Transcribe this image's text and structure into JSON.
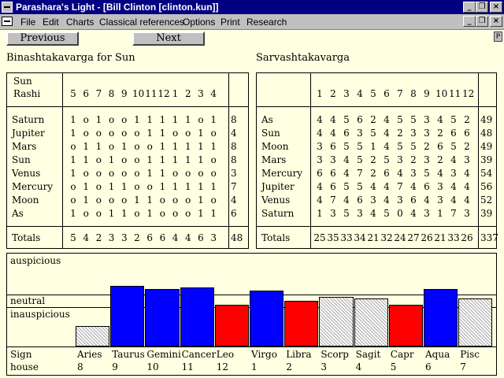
{
  "window": {
    "title": "Parashara's Light - [Bill  Clinton [clinton.kun]]",
    "min_label": "_",
    "restore_label": "❐",
    "close_label": "×"
  },
  "menu": [
    "File",
    "Edit",
    "Charts",
    "Classical references",
    "Options",
    "Print",
    "Research"
  ],
  "nav": {
    "previous": "Previous",
    "next": "Next",
    "print_small": "P"
  },
  "bav": {
    "heading": "Binashtakavarga for Sun",
    "header_label_1": "Sun",
    "header_label_2": "Rashi",
    "rashi": [
      "5",
      "6",
      "7",
      "8",
      "9",
      "10",
      "11",
      "12",
      "1",
      "2",
      "3",
      "4"
    ],
    "rows": [
      {
        "label": "Saturn",
        "values": [
          "1",
          "o",
          "1",
          "o",
          "o",
          "1",
          "1",
          "1",
          "1",
          "1",
          "o",
          "1"
        ],
        "total": "8"
      },
      {
        "label": "Jupiter",
        "values": [
          "1",
          "o",
          "o",
          "o",
          "o",
          "o",
          "1",
          "1",
          "o",
          "o",
          "1",
          "o"
        ],
        "total": "4"
      },
      {
        "label": "Mars",
        "values": [
          "o",
          "1",
          "1",
          "o",
          "1",
          "o",
          "o",
          "1",
          "1",
          "1",
          "1",
          "1"
        ],
        "total": "8"
      },
      {
        "label": "Sun",
        "values": [
          "1",
          "1",
          "o",
          "1",
          "o",
          "o",
          "1",
          "1",
          "1",
          "1",
          "1",
          "o"
        ],
        "total": "8"
      },
      {
        "label": "Venus",
        "values": [
          "1",
          "o",
          "o",
          "o",
          "o",
          "o",
          "1",
          "1",
          "o",
          "o",
          "o",
          "o"
        ],
        "total": "3"
      },
      {
        "label": "Mercury",
        "values": [
          "o",
          "1",
          "o",
          "1",
          "1",
          "o",
          "o",
          "1",
          "1",
          "1",
          "1",
          "1"
        ],
        "total": "7"
      },
      {
        "label": "Moon",
        "values": [
          "o",
          "1",
          "o",
          "o",
          "o",
          "1",
          "1",
          "o",
          "o",
          "o",
          "1",
          "o"
        ],
        "total": "4"
      },
      {
        "label": "As",
        "values": [
          "1",
          "o",
          "o",
          "1",
          "1",
          "o",
          "1",
          "o",
          "o",
          "o",
          "1",
          "1"
        ],
        "total": "6"
      }
    ],
    "totals_label": "Totals",
    "totals": [
      "5",
      "4",
      "2",
      "3",
      "3",
      "2",
      "6",
      "6",
      "4",
      "4",
      "6",
      "3"
    ],
    "grand_total": "48"
  },
  "sav": {
    "heading": "Sarvashtakavarga",
    "houses": [
      "1",
      "2",
      "3",
      "4",
      "5",
      "6",
      "7",
      "8",
      "9",
      "10",
      "11",
      "12"
    ],
    "rows": [
      {
        "label": "As",
        "values": [
          "4",
          "4",
          "5",
          "6",
          "2",
          "4",
          "5",
          "5",
          "3",
          "4",
          "5",
          "2"
        ],
        "total": "49"
      },
      {
        "label": "Sun",
        "values": [
          "4",
          "4",
          "6",
          "3",
          "5",
          "4",
          "2",
          "3",
          "3",
          "2",
          "6",
          "6"
        ],
        "total": "48"
      },
      {
        "label": "Moon",
        "values": [
          "3",
          "6",
          "5",
          "5",
          "1",
          "4",
          "5",
          "5",
          "2",
          "6",
          "5",
          "2"
        ],
        "total": "49"
      },
      {
        "label": "Mars",
        "values": [
          "3",
          "3",
          "4",
          "5",
          "2",
          "5",
          "3",
          "2",
          "3",
          "2",
          "4",
          "3"
        ],
        "total": "39"
      },
      {
        "label": "Mercury",
        "values": [
          "6",
          "6",
          "4",
          "7",
          "2",
          "6",
          "4",
          "3",
          "5",
          "4",
          "3",
          "4"
        ],
        "total": "54"
      },
      {
        "label": "Jupiter",
        "values": [
          "4",
          "6",
          "5",
          "5",
          "4",
          "4",
          "7",
          "4",
          "6",
          "3",
          "4",
          "4"
        ],
        "total": "56"
      },
      {
        "label": "Venus",
        "values": [
          "4",
          "7",
          "4",
          "6",
          "3",
          "4",
          "3",
          "6",
          "4",
          "3",
          "4",
          "4"
        ],
        "total": "52"
      },
      {
        "label": "Saturn",
        "values": [
          "1",
          "3",
          "5",
          "3",
          "4",
          "5",
          "0",
          "4",
          "3",
          "1",
          "7",
          "3"
        ],
        "total": "39"
      }
    ],
    "totals_label": "Totals",
    "totals": [
      "25",
      "35",
      "33",
      "34",
      "21",
      "32",
      "24",
      "27",
      "26",
      "21",
      "33",
      "26"
    ],
    "grand_total": "337"
  },
  "strength": {
    "label_auspicious": "auspicious",
    "label_neutral": "neutral",
    "label_inauspicious": "inauspicious",
    "sign_label": "Sign",
    "house_label": "house",
    "signs": [
      {
        "name": "Aries",
        "house": "8",
        "value": 5,
        "quality": "neutral"
      },
      {
        "name": "Taurus",
        "house": "9",
        "value": 35,
        "quality": "auspicious"
      },
      {
        "name": "Gemini",
        "house": "10",
        "value": 33,
        "quality": "auspicious"
      },
      {
        "name": "Cancer",
        "house": "11",
        "value": 34,
        "quality": "auspicious"
      },
      {
        "name": "Leo",
        "house": "12",
        "value": 21,
        "quality": "inauspicious"
      },
      {
        "name": "Virgo",
        "house": "1",
        "value": 32,
        "quality": "auspicious"
      },
      {
        "name": "Libra",
        "house": "2",
        "value": 24,
        "quality": "inauspicious"
      },
      {
        "name": "Scorp",
        "house": "3",
        "value": 27,
        "quality": "neutral"
      },
      {
        "name": "Sagit",
        "house": "4",
        "value": 26,
        "quality": "neutral"
      },
      {
        "name": "Capr",
        "house": "5",
        "value": 21,
        "quality": "inauspicious"
      },
      {
        "name": "Aqua",
        "house": "6",
        "value": 33,
        "quality": "auspicious"
      },
      {
        "name": "Pisc",
        "house": "7",
        "value": 26,
        "quality": "neutral"
      }
    ],
    "colors": {
      "auspicious": "#0000ff",
      "inauspicious": "#ff0000",
      "neutral": "hatched-gray"
    }
  }
}
